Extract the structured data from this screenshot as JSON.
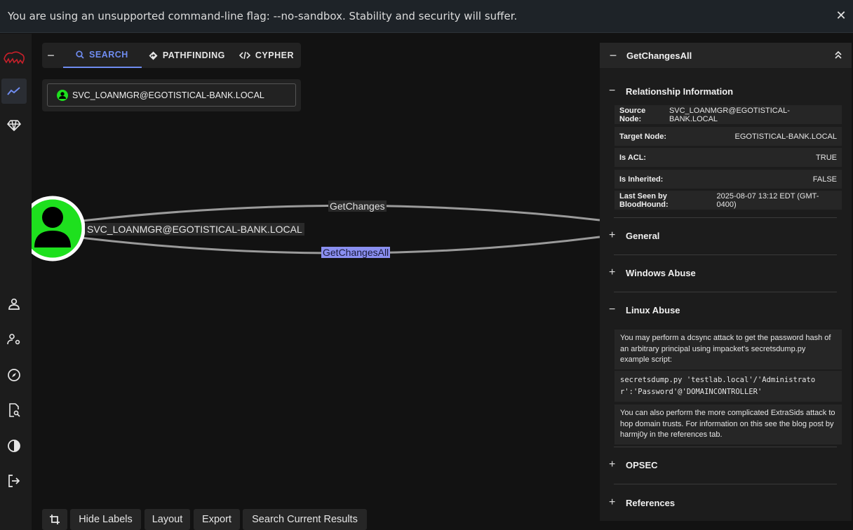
{
  "warning": {
    "text": "You are using an unsupported command-line flag: --no-sandbox. Stability and security will suffer.",
    "close_icon": "close-icon"
  },
  "nav": {
    "items": [
      "logo-icon",
      "explore-icon",
      "gem-icon",
      "user-icon",
      "user-settings-icon",
      "compass-icon",
      "file-search-icon",
      "contrast-icon",
      "logout-icon"
    ]
  },
  "tabs": {
    "collapse": "−",
    "search": "SEARCH",
    "pathfinding": "PATHFINDING",
    "cypher": "CYPHER"
  },
  "search": {
    "value": "SVC_LOANMGR@EGOTISTICAL-BANK.LOCAL"
  },
  "graph": {
    "node_label": "SVC_LOANMGR@EGOTISTICAL-BANK.LOCAL",
    "edge1": "GetChanges",
    "edge2": "GetChangesAll",
    "node_color": "#1ee01e"
  },
  "bottom": {
    "hide_labels": "Hide Labels",
    "layout": "Layout",
    "export": "Export",
    "search_current": "Search Current Results"
  },
  "panel": {
    "title": "GetChangesAll",
    "relationship": {
      "title": "Relationship Information",
      "rows": [
        {
          "k": "Source Node:",
          "v": "SVC_LOANMGR@EGOTISTICAL-BANK.LOCAL"
        },
        {
          "k": "Target Node:",
          "v": "EGOTISTICAL-BANK.LOCAL"
        },
        {
          "k": "Is ACL:",
          "v": "TRUE"
        },
        {
          "k": "Is Inherited:",
          "v": "FALSE"
        },
        {
          "k": "Last Seen by BloodHound:",
          "v": "2025-08-07 13:12 EDT (GMT-0400)"
        }
      ]
    },
    "general": "General",
    "windows_abuse": "Windows Abuse",
    "linux_abuse": {
      "title": "Linux Abuse",
      "p1": "You may perform a dcsync attack to get the password hash of an arbitrary principal using impacket's secretsdump.py example script:",
      "code": "secretsdump.py 'testlab.local'/'Administrator':'Password'@'DOMAINCONTROLLER'",
      "p2": "You can also perform the more complicated ExtraSids attack to hop domain trusts. For information on this see the blog post by harmj0y in the references tab."
    },
    "opsec": "OPSEC",
    "references": "References",
    "plus": "+",
    "minus": "−"
  },
  "colors": {
    "accent": "#6f8cf0",
    "node_green": "#1ee01e",
    "highlight": "#8a8ff0"
  }
}
